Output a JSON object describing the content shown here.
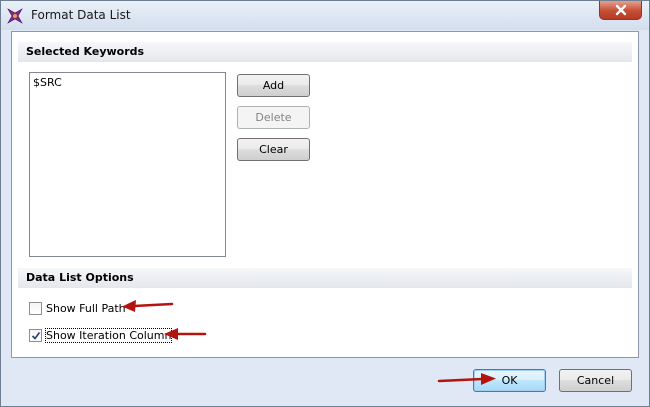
{
  "window": {
    "title": "Format Data List"
  },
  "sections": {
    "keywords_header": "Selected Keywords",
    "options_header": "Data List Options"
  },
  "keywords": {
    "items": [
      "$SRC"
    ]
  },
  "buttons": {
    "add": "Add",
    "delete": "Delete",
    "clear": "Clear",
    "ok": "OK",
    "cancel": "Cancel"
  },
  "options": {
    "show_full_path": {
      "label": "Show Full Path",
      "checked": false
    },
    "show_iteration_column": {
      "label": "Show Iteration Column",
      "checked": true
    }
  },
  "colors": {
    "annotation_arrow": "#b3140f"
  }
}
